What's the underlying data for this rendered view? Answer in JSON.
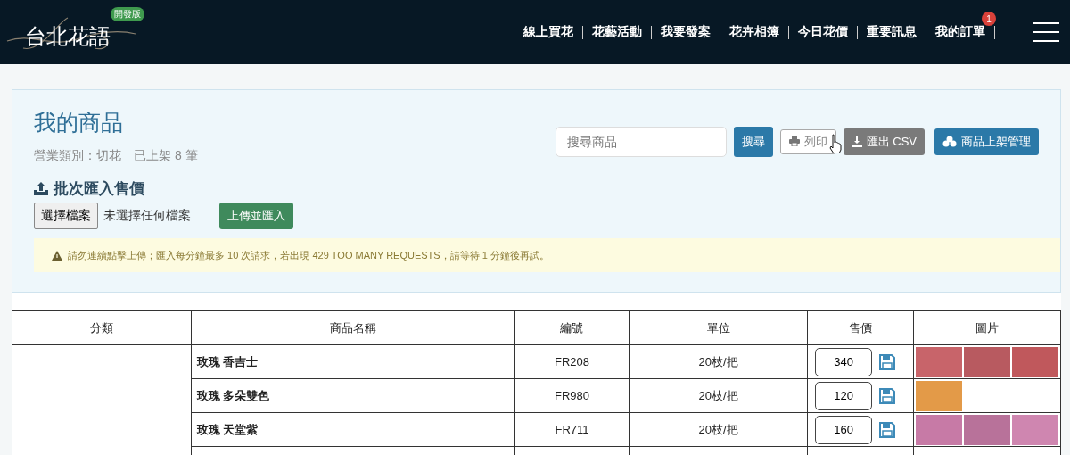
{
  "header": {
    "logo": "台北花語",
    "env_badge": "開發版",
    "nav": [
      {
        "label": "線上買花"
      },
      {
        "label": "花藝活動"
      },
      {
        "label": "我要發案"
      },
      {
        "label": "花卉相簿"
      },
      {
        "label": "今日花價"
      },
      {
        "label": "重要訊息"
      },
      {
        "label": "我的訂單",
        "badge": "1"
      }
    ]
  },
  "panel": {
    "title": "我的商品",
    "subtitle": "營業類別：切花　已上架 8 筆",
    "search": {
      "placeholder": "搜尋商品"
    },
    "buttons": [
      {
        "kind": "search",
        "label": "搜尋"
      },
      {
        "kind": "print",
        "label": "列印"
      },
      {
        "kind": "csv",
        "label": "匯出 CSV"
      },
      {
        "kind": "manage",
        "label": "商品上架管理"
      }
    ],
    "import": {
      "title": "批次匯入售價",
      "file_button": "選擇檔案",
      "file_status": "未選擇任何檔案",
      "upload_button": "上傳並匯入"
    },
    "alert": "請勿連續點擊上傳；匯入每分鐘最多 10 次請求，若出現 429 TOO MANY REQUESTS，請等待 1 分鐘後再試。"
  },
  "table": {
    "columns": [
      "分類",
      "商品名稱",
      "編號",
      "單位",
      "售價",
      "圖片"
    ],
    "rows": [
      {
        "name": "玫瑰 香吉士",
        "code": "FR208",
        "unit": "20枝/把",
        "price": "340",
        "photos": [
          {
            "color": "#c8646a"
          },
          {
            "color": "#b85a60"
          },
          {
            "color": "#c0585c"
          }
        ]
      },
      {
        "name": "玫瑰 多朵雙色",
        "code": "FR980",
        "unit": "20枝/把",
        "price": "120",
        "photos": [
          {
            "color": "#e39a48"
          }
        ]
      },
      {
        "name": "玫瑰 天堂紫",
        "code": "FR711",
        "unit": "20枝/把",
        "price": "160",
        "photos": [
          {
            "color": "#c77aa6"
          },
          {
            "color": "#b8729a"
          },
          {
            "color": "#cf86b0"
          }
        ]
      }
    ]
  }
}
